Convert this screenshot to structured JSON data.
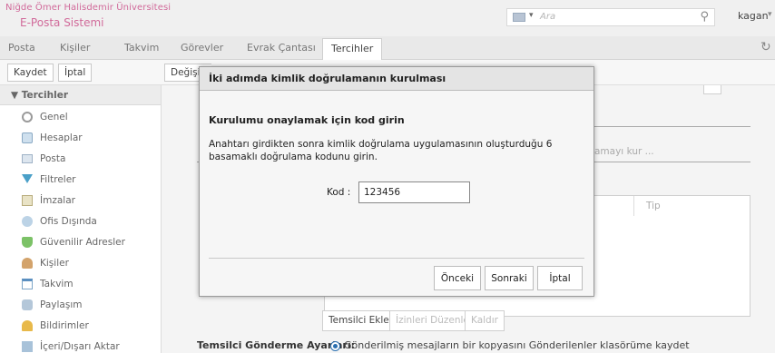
{
  "header": {
    "university": "Niğde Ömer Halisdemir Üniversitesi",
    "system": "E-Posta Sistemi",
    "search_placeholder": "Ara",
    "user": "kagan"
  },
  "tabs": [
    "Posta",
    "Kişiler",
    "Takvim",
    "Görevler",
    "Evrak Çantası",
    "Tercihler"
  ],
  "active_tab": "Tercihler",
  "toolbar": {
    "save": "Kaydet",
    "cancel": "İptal",
    "changes": "Değişik"
  },
  "sidebar": {
    "heading": "Tercihler",
    "items": [
      {
        "label": "Genel",
        "icon": "gear-icon"
      },
      {
        "label": "Hesaplar",
        "icon": "accounts-icon"
      },
      {
        "label": "Posta",
        "icon": "mail-icon"
      },
      {
        "label": "Filtreler",
        "icon": "filter-icon"
      },
      {
        "label": "İmzalar",
        "icon": "signature-icon"
      },
      {
        "label": "Ofis Dışında",
        "icon": "out-of-office-icon"
      },
      {
        "label": "Güvenilir Adresler",
        "icon": "shield-icon"
      },
      {
        "label": "Kişiler",
        "icon": "contact-icon"
      },
      {
        "label": "Takvim",
        "icon": "calendar-icon"
      },
      {
        "label": "Paylaşım",
        "icon": "share-icon"
      },
      {
        "label": "Bildirimler",
        "icon": "bell-icon"
      },
      {
        "label": "İçeri/Dışarı Aktar",
        "icon": "import-export-icon"
      }
    ]
  },
  "main": {
    "setup_link_fragment": "amayı kur ...",
    "column_tip": "Tip",
    "buttons": {
      "add_delegate": "Temsilci Ekle",
      "edit_permissions": "İzinleri Düzenle",
      "remove": "Kaldır"
    },
    "delegate_send_label": "Temsilci Gönderme Ayarları:",
    "delegate_send_option": "Gönderilmiş mesajların bir kopyasını Gönderilenler klasörüme kaydet"
  },
  "dialog": {
    "title": "İki adımda kimlik doğrulamanın kurulması",
    "heading": "Kurulumu onaylamak için kod girin",
    "description": "Anahtarı girdikten sonra kimlik doğrulama uygulamasının oluşturduğu 6 basamaklı doğrulama kodunu girin.",
    "code_label": "Kod :",
    "code_value": "123456",
    "buttons": {
      "previous": "Önceki",
      "next": "Sonraki",
      "cancel": "İptal"
    }
  },
  "colors": {
    "brand": "#d16a9a",
    "accent": "#2a6fb0"
  }
}
